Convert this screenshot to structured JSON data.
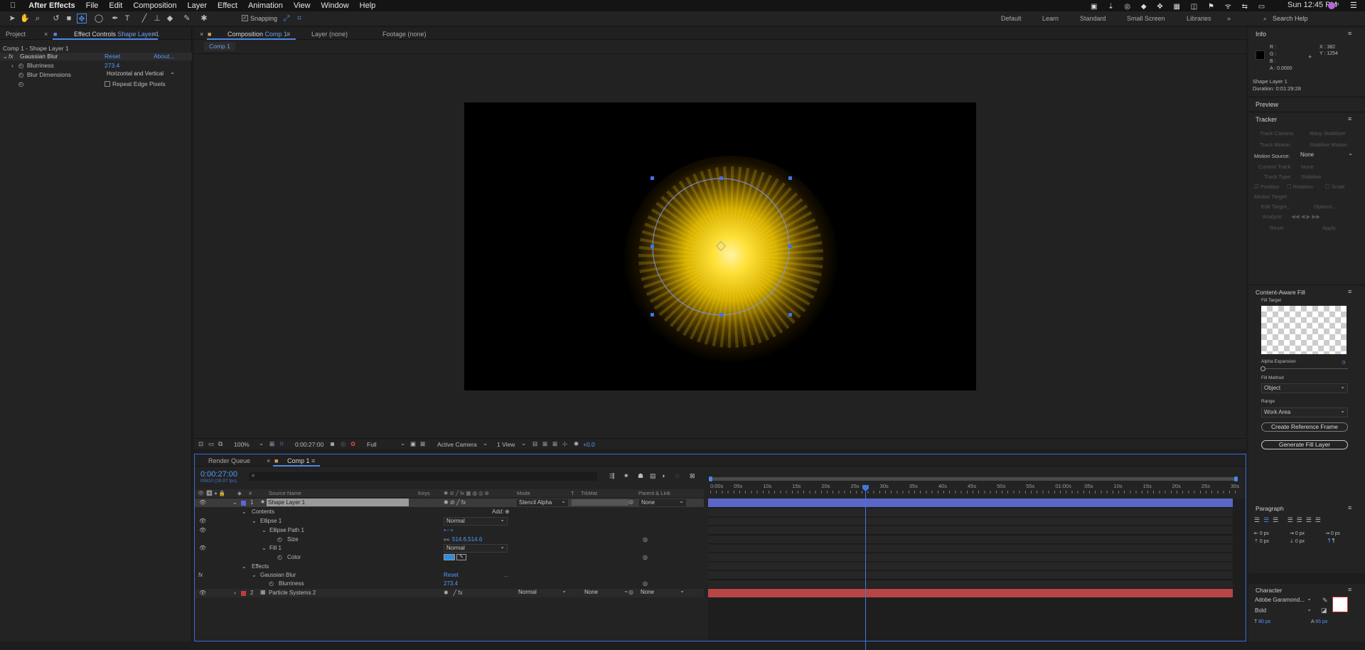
{
  "menubar": {
    "app_name": "After Effects",
    "items": [
      "File",
      "Edit",
      "Composition",
      "Layer",
      "Effect",
      "Animation",
      "View",
      "Window",
      "Help"
    ],
    "clock": "Sun 12:45 PM"
  },
  "toolbar": {
    "snapping_label": "Snapping",
    "workspaces": [
      "Default",
      "Learn",
      "Standard",
      "Small Screen",
      "Libraries"
    ],
    "search_placeholder": "Search Help"
  },
  "left_panel": {
    "tab_project": "Project",
    "tab_effect_controls_prefix": "Effect Controls",
    "tab_effect_controls_layer": "Shape Layer 1",
    "breadcrumb": "Comp 1 - Shape Layer 1",
    "effect_name": "Gaussian Blur",
    "reset_label": "Reset",
    "about_label": "About...",
    "blurriness_label": "Blurriness",
    "blurriness_value": "273.4",
    "blur_dimensions_label": "Blur Dimensions",
    "blur_dimensions_value": "Horizontal and Vertical",
    "repeat_edge_label": "Repeat Edge Pixels"
  },
  "viewer": {
    "tab_composition_prefix": "Composition",
    "tab_composition_name": "Comp 1",
    "tab_layer": "Layer (none)",
    "tab_footage": "Footage (none)",
    "subtab": "Comp 1",
    "zoom": "100%",
    "timecode": "0:00:27:00",
    "resolution": "Full",
    "camera": "Active Camera",
    "views": "1 View",
    "exposure": "+0.0"
  },
  "timeline": {
    "tab_render_queue": "Render Queue",
    "tab_comp": "Comp 1",
    "current_time": "0:00:27:00",
    "frame_info": "00810 (29.97 fps)",
    "columns": {
      "source_name": "Source Name",
      "keys": "Keys",
      "mode": "Mode",
      "t": "T",
      "trkmat": "TrkMat",
      "parent": "Parent & Link"
    },
    "ruler": [
      "0:00s",
      "05s",
      "10s",
      "15s",
      "20s",
      "25s",
      "30s",
      "35s",
      "40s",
      "45s",
      "50s",
      "55s",
      "01:00s",
      "05s",
      "10s",
      "15s",
      "20s",
      "25s",
      "30s"
    ],
    "layer1": {
      "index": "1",
      "name": "Shape Layer 1",
      "mode": "Stencil Alpha",
      "parent": "None"
    },
    "contents_label": "Contents",
    "add_label": "Add:",
    "ellipse1_label": "Ellipse 1",
    "ellipse1_mode": "Normal",
    "ellipse_path_label": "Ellipse Path 1",
    "size_label": "Size",
    "size_value": "514.6,514.6",
    "fill_label": "Fill 1",
    "fill_mode": "Normal",
    "color_label": "Color",
    "effects_label": "Effects",
    "gaussian_label": "Gaussian Blur",
    "gaussian_reset": "Reset",
    "gaussian_dots": "...",
    "blurriness_label": "Blurriness",
    "blurriness_value": "273.4",
    "layer2": {
      "index": "2",
      "name": "Particle Systems 2",
      "mode": "Normal",
      "trkmat": "None",
      "parent": "None"
    }
  },
  "right_panel": {
    "info_title": "Info",
    "info_r": "R :",
    "info_g": "G :",
    "info_b": "B :",
    "info_a": "A : 0.0000",
    "info_x": "X : 382",
    "info_y": "Y : 1254",
    "info_layer": "Shape Layer 1",
    "info_duration": "Duration: 0:01:29:28",
    "preview_title": "Preview",
    "tracker_title": "Tracker",
    "track_camera": "Track Camera",
    "warp_stabilizer": "Warp Stabilizer",
    "track_motion": "Track Motion",
    "stabilize_motion": "Stabilize Motion",
    "motion_source_label": "Motion Source:",
    "motion_source_value": "None",
    "current_track_label": "Current Track:",
    "current_track_value": "None",
    "track_type_label": "Track Type:",
    "track_type_value": "Stabilize",
    "position": "Position",
    "rotation": "Rotation",
    "scale": "Scale",
    "motion_target": "Motion Target:",
    "edit_target": "Edit Target...",
    "options": "Options...",
    "analyze": "Analyze:",
    "reset": "Reset",
    "apply": "Apply",
    "caf_title": "Content-Aware Fill",
    "fill_target": "Fill Target",
    "alpha_expansion": "Alpha Expansion",
    "alpha_value": "0",
    "fill_method": "Fill Method",
    "fill_method_value": "Object",
    "range": "Range",
    "range_value": "Work Area",
    "create_ref": "Create Reference Frame",
    "generate": "Generate Fill Layer",
    "paragraph_title": "Paragraph",
    "px_values": [
      "0 px",
      "0 px",
      "0 px",
      "0 px",
      "0 px",
      "0 px"
    ],
    "character_title": "Character",
    "font_name": "Adobe Garamond...",
    "font_style": "Bold",
    "font_size": "80 px",
    "leading": "65 px"
  },
  "colors": {
    "accent": "#4d86e5",
    "layer1_bar": "#5a66c8",
    "layer2_bar": "#b84545",
    "glow": "#ffd21a"
  }
}
